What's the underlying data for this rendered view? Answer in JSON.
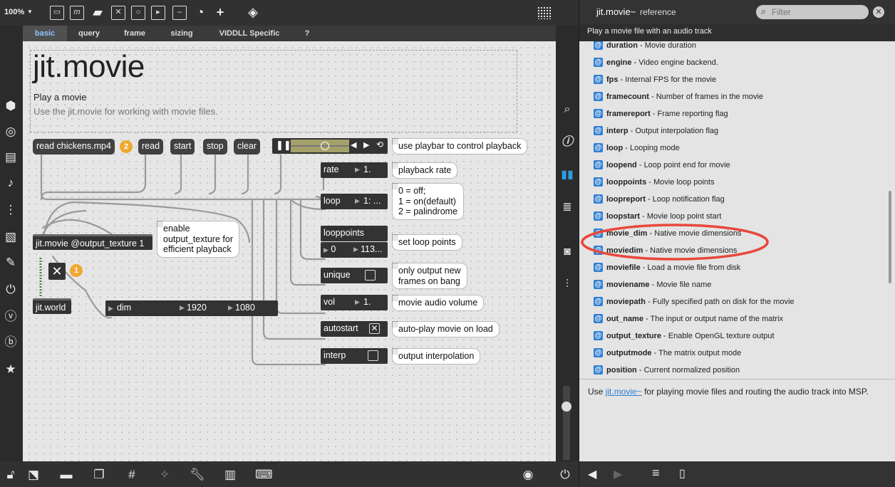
{
  "toolbar": {
    "zoom": "100%",
    "zoom_caret": "▼",
    "icons": [
      "new-object-icon",
      "message-box-icon",
      "comment-icon",
      "toggle-icon",
      "button-icon",
      "playbar-icon",
      "slider-icon",
      "dial-icon",
      "add-icon",
      "paint-bucket-icon",
      "grid-icon"
    ]
  },
  "tabs": [
    {
      "label": "basic",
      "active": true
    },
    {
      "label": "query",
      "active": false
    },
    {
      "label": "frame",
      "active": false
    },
    {
      "label": "sizing",
      "active": false
    },
    {
      "label": "VIDDLL Specific",
      "active": false
    },
    {
      "label": "?",
      "active": false
    }
  ],
  "patcher": {
    "title": "jit.movie",
    "subtitle": "Play a movie",
    "description": "Use the jit.movie for working with movie files.",
    "messages": {
      "read_chickens": "read chickens.mp4",
      "read": "read",
      "start": "start",
      "stop": "stop",
      "clear": "clear"
    },
    "badges": {
      "b2": "2",
      "b1": "1"
    },
    "objects": {
      "jit_movie": "jit.movie @output_texture 1",
      "jit_world": "jit.world"
    },
    "attrui": {
      "rate": {
        "label": "rate",
        "value": "1."
      },
      "loop": {
        "label": "loop",
        "value": "1: ..."
      },
      "looppoints": {
        "label": "looppoints",
        "v1": "0",
        "v2": "113..."
      },
      "unique": {
        "label": "unique"
      },
      "vol": {
        "label": "vol",
        "value": "1."
      },
      "autostart": {
        "label": "autostart"
      },
      "interp": {
        "label": "interp"
      },
      "dim": {
        "label": "dim",
        "v1": "1920",
        "v2": "1080"
      }
    },
    "comments": {
      "playbar": "use playbar to control playback",
      "rate": "playback rate",
      "loop": [
        "0 = off;",
        "1 = on(default)",
        "2 = palindrome"
      ],
      "texture": [
        "enable",
        "output_texture for",
        "efficient playback"
      ],
      "looppoints": "set loop points",
      "unique": [
        "only output new",
        "frames on bang"
      ],
      "vol": "movie audio volume",
      "autostart": "auto-play movie on load",
      "interp": "output interpolation"
    },
    "checkbox_mark": "✕"
  },
  "reference": {
    "title": "jit.movie~",
    "title_suffix": "reference",
    "filter_placeholder": "Filter",
    "summary": "Play a movie file with an audio track",
    "items": [
      {
        "name": "duration",
        "desc": "Movie duration"
      },
      {
        "name": "engine",
        "desc": "Video engine backend."
      },
      {
        "name": "fps",
        "desc": "Internal FPS for the movie"
      },
      {
        "name": "framecount",
        "desc": "Number of frames in the movie"
      },
      {
        "name": "framereport",
        "desc": "Frame reporting flag"
      },
      {
        "name": "interp",
        "desc": "Output interpolation flag"
      },
      {
        "name": "loop",
        "desc": "Looping mode"
      },
      {
        "name": "loopend",
        "desc": "Loop point end for movie"
      },
      {
        "name": "looppoints",
        "desc": "Movie loop points"
      },
      {
        "name": "loopreport",
        "desc": "Loop notification flag"
      },
      {
        "name": "loopstart",
        "desc": "Movie loop point start"
      },
      {
        "name": "movie_dim",
        "desc": "Native movie dimensions"
      },
      {
        "name": "moviedim",
        "desc": "Native movie dimensions"
      },
      {
        "name": "moviefile",
        "desc": "Load a movie file from disk"
      },
      {
        "name": "moviename",
        "desc": "Movie file name"
      },
      {
        "name": "moviepath",
        "desc": "Fully specified path on disk for the movie"
      },
      {
        "name": "out_name",
        "desc": "The input or output name of the matrix"
      },
      {
        "name": "output_texture",
        "desc": "Enable OpenGL texture output"
      },
      {
        "name": "outputmode",
        "desc": "The matrix output mode"
      },
      {
        "name": "position",
        "desc": "Current normalized position"
      }
    ],
    "usage_prefix": "Use",
    "usage_link": "jit.movie~",
    "usage_suffix": "for playing movie files and routing the audio track into MSP.",
    "highlight_color": "#e8483a"
  },
  "colors": {
    "accent": "#2f7fd3",
    "badge": "#f0a830",
    "tab_active": "#8fc6ff"
  }
}
